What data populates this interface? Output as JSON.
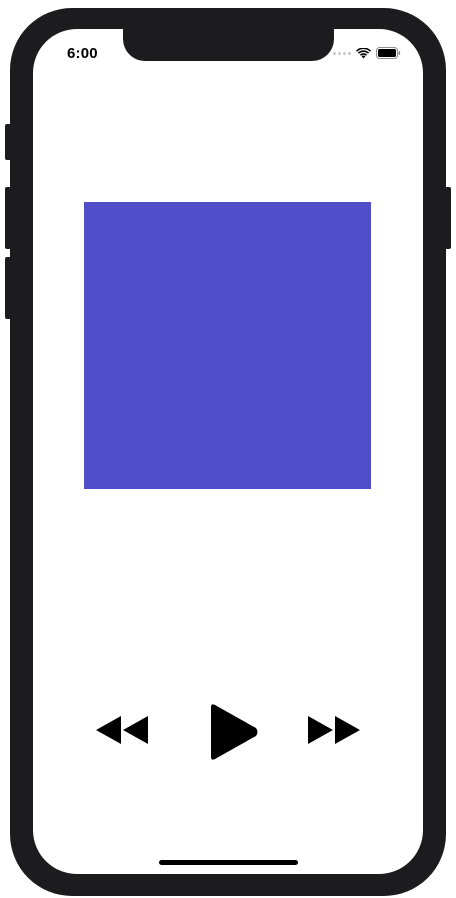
{
  "status_bar": {
    "time": "6:00",
    "signal_icon": "signal-dots-icon",
    "wifi_icon": "wifi-icon",
    "battery_icon": "battery-icon"
  },
  "player": {
    "artwork_color": "#514ec9",
    "controls": {
      "rewind_icon": "rewind-icon",
      "play_icon": "play-icon",
      "fast_forward_icon": "fast-forward-icon"
    }
  },
  "colors": {
    "device_frame": "#1c1c1e",
    "screen_background": "#ffffff",
    "control_color": "#000000"
  }
}
